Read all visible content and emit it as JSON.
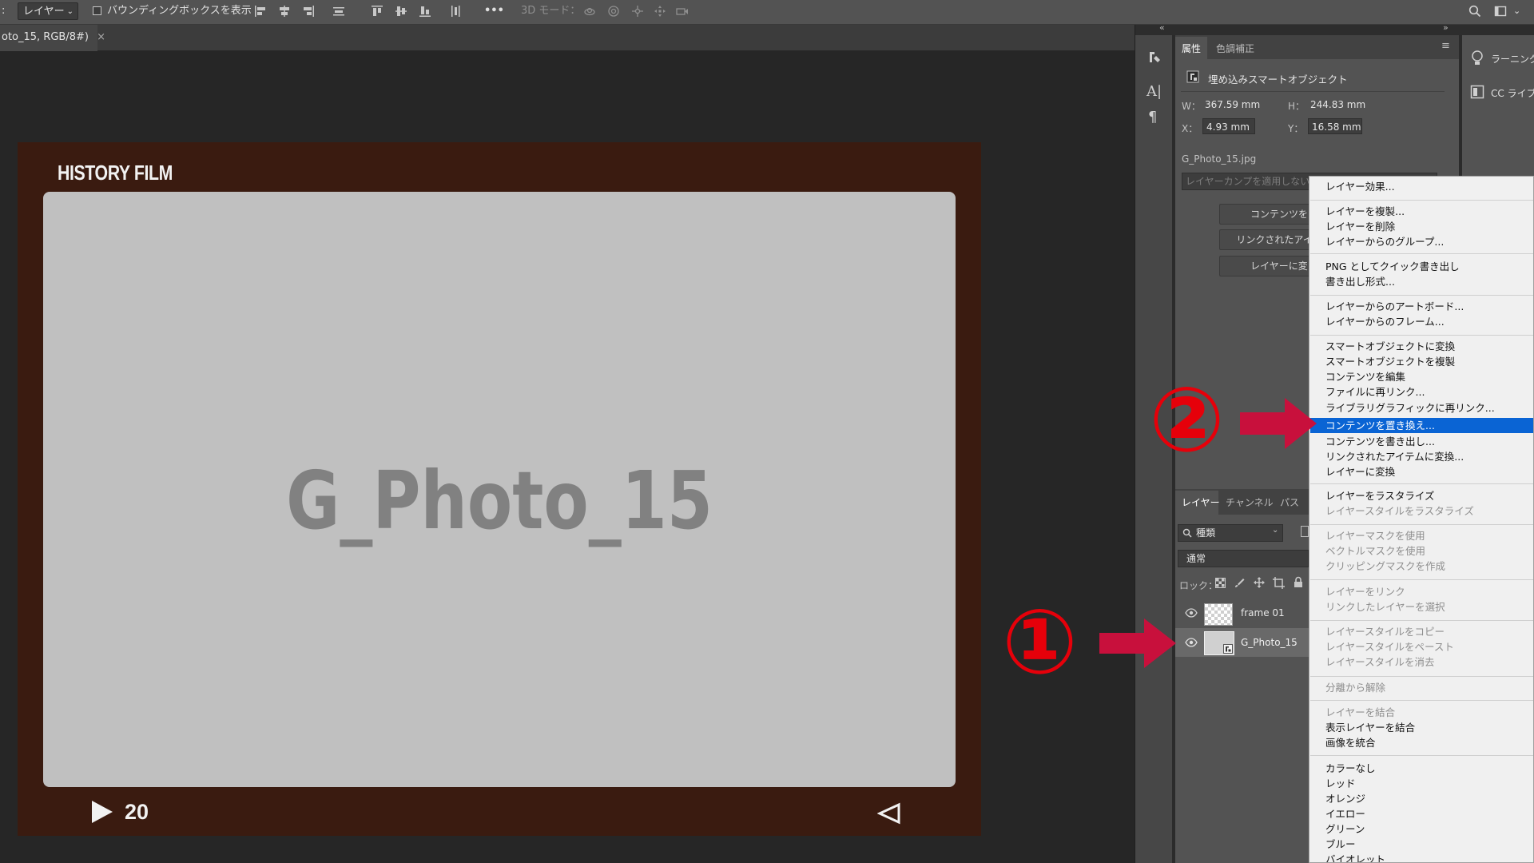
{
  "options_bar": {
    "tool_mode": "レイヤー",
    "bounding_box_label": "バウンディングボックスを表示",
    "mode_3d": "3D モード：",
    "more": "•••"
  },
  "document": {
    "tab_title": "oto_15, RGB/8#)",
    "close": "×"
  },
  "canvas": {
    "film_title": "HISTORY FILM",
    "photo_label": "G_Photo_15",
    "page_number": "20"
  },
  "properties_panel": {
    "tabs": [
      "属性",
      "色調補正"
    ],
    "object_type": "埋め込みスマートオブジェクト",
    "w_label": "W：",
    "w_value": "367.59 mm",
    "h_label": "H：",
    "h_value": "244.83 mm",
    "x_label": "X：",
    "x_value": "4.93 mm",
    "y_label": "Y：",
    "y_value": "16.58 mm",
    "filename": "G_Photo_15.jpg",
    "layer_comp_placeholder": "レイヤーカンプを適用しない",
    "buttons": [
      "コンテンツを",
      "リンクされたアイテ",
      "レイヤーに変"
    ]
  },
  "far_panel": {
    "learn": "ラーニング",
    "cc_libraries": "CC ライブラ"
  },
  "layers_panel": {
    "tabs": [
      "レイヤー",
      "チャンネル",
      "パス"
    ],
    "filter_kind": "種類",
    "blend_mode": "通常",
    "lock_label": "ロック：",
    "layers": [
      {
        "name": "frame 01"
      },
      {
        "name": "G_Photo_15"
      }
    ]
  },
  "context_menu": {
    "items": [
      {
        "label": "レイヤー効果...",
        "disabled": false
      },
      {
        "label": "レイヤーを複製...",
        "disabled": false
      },
      {
        "label": "レイヤーを削除",
        "disabled": false
      },
      {
        "label": "レイヤーからのグループ...",
        "disabled": false
      },
      {
        "label": "PNG としてクイック書き出し",
        "disabled": false
      },
      {
        "label": "書き出し形式...",
        "disabled": false
      },
      {
        "label": "レイヤーからのアートボード...",
        "disabled": false
      },
      {
        "label": "レイヤーからのフレーム...",
        "disabled": false
      },
      {
        "label": "スマートオブジェクトに変換",
        "disabled": false
      },
      {
        "label": "スマートオブジェクトを複製",
        "disabled": false
      },
      {
        "label": "コンテンツを編集",
        "disabled": false
      },
      {
        "label": "ファイルに再リンク...",
        "disabled": false
      },
      {
        "label": "ライブラリグラフィックに再リンク...",
        "disabled": false
      },
      {
        "label": "コンテンツを置き換え...",
        "disabled": false,
        "highlighted": true
      },
      {
        "label": "コンテンツを書き出し...",
        "disabled": false
      },
      {
        "label": "リンクされたアイテムに変換...",
        "disabled": false
      },
      {
        "label": "レイヤーに変換",
        "disabled": false
      },
      {
        "label": "レイヤーをラスタライズ",
        "disabled": false
      },
      {
        "label": "レイヤースタイルをラスタライズ",
        "disabled": true
      },
      {
        "label": "レイヤーマスクを使用",
        "disabled": true
      },
      {
        "label": "ベクトルマスクを使用",
        "disabled": true
      },
      {
        "label": "クリッピングマスクを作成",
        "disabled": true
      },
      {
        "label": "レイヤーをリンク",
        "disabled": true
      },
      {
        "label": "リンクしたレイヤーを選択",
        "disabled": true
      },
      {
        "label": "レイヤースタイルをコピー",
        "disabled": true
      },
      {
        "label": "レイヤースタイルをペースト",
        "disabled": true
      },
      {
        "label": "レイヤースタイルを消去",
        "disabled": true
      },
      {
        "label": "分離から解除",
        "disabled": true
      },
      {
        "label": "レイヤーを結合",
        "disabled": true
      },
      {
        "label": "表示レイヤーを結合",
        "disabled": false
      },
      {
        "label": "画像を統合",
        "disabled": false
      },
      {
        "label": "カラーなし",
        "disabled": false
      },
      {
        "label": "レッド",
        "disabled": false
      },
      {
        "label": "オレンジ",
        "disabled": false
      },
      {
        "label": "イエロー",
        "disabled": false
      },
      {
        "label": "グリーン",
        "disabled": false
      },
      {
        "label": "ブルー",
        "disabled": false
      },
      {
        "label": "バイオレット",
        "disabled": false
      }
    ]
  },
  "annotations": {
    "step1": "①",
    "step2": "②",
    "arrow_color": "#c8103c",
    "number_color": "#e6000a"
  },
  "colors": {
    "highlight": "#0a64d4",
    "film_frame": "#3a1b10"
  }
}
